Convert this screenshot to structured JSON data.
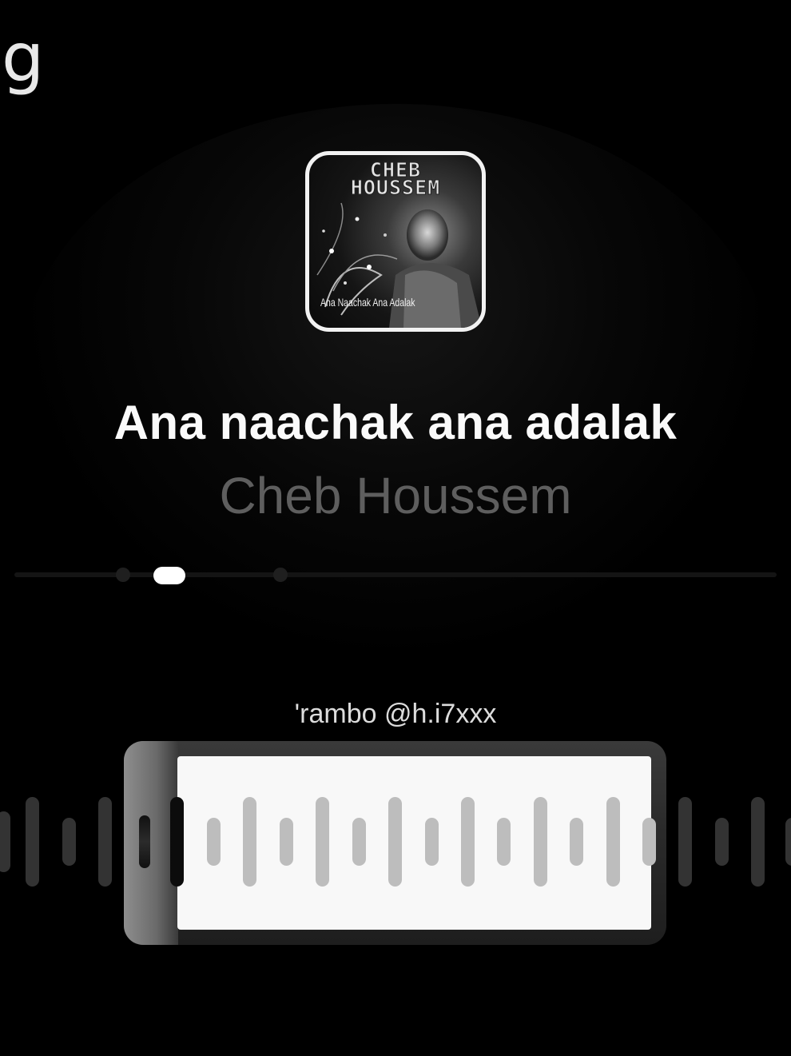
{
  "page": {
    "edge_text": "g"
  },
  "album": {
    "art_title_line1": "CHEB",
    "art_title_line2": "HOUSSEM",
    "art_caption": "Ana Naachak Ana Adalak"
  },
  "track": {
    "title": "Ana naachak ana adalak",
    "artist": "Cheb Houssem"
  },
  "progress": {
    "position": 0.2
  },
  "clip": {
    "credit": "'rambo @h.i7xxx"
  },
  "colors": {
    "background": "#000000",
    "title": "#fafafa",
    "artist": "#5e5e5e",
    "selection_window": "#f8f8f8",
    "wave_inactive": "#333333",
    "wave_active": "#bdbdbd"
  },
  "icons": {
    "progress_thumb": "pill-thumb",
    "trim_handle": "drag-handle"
  }
}
